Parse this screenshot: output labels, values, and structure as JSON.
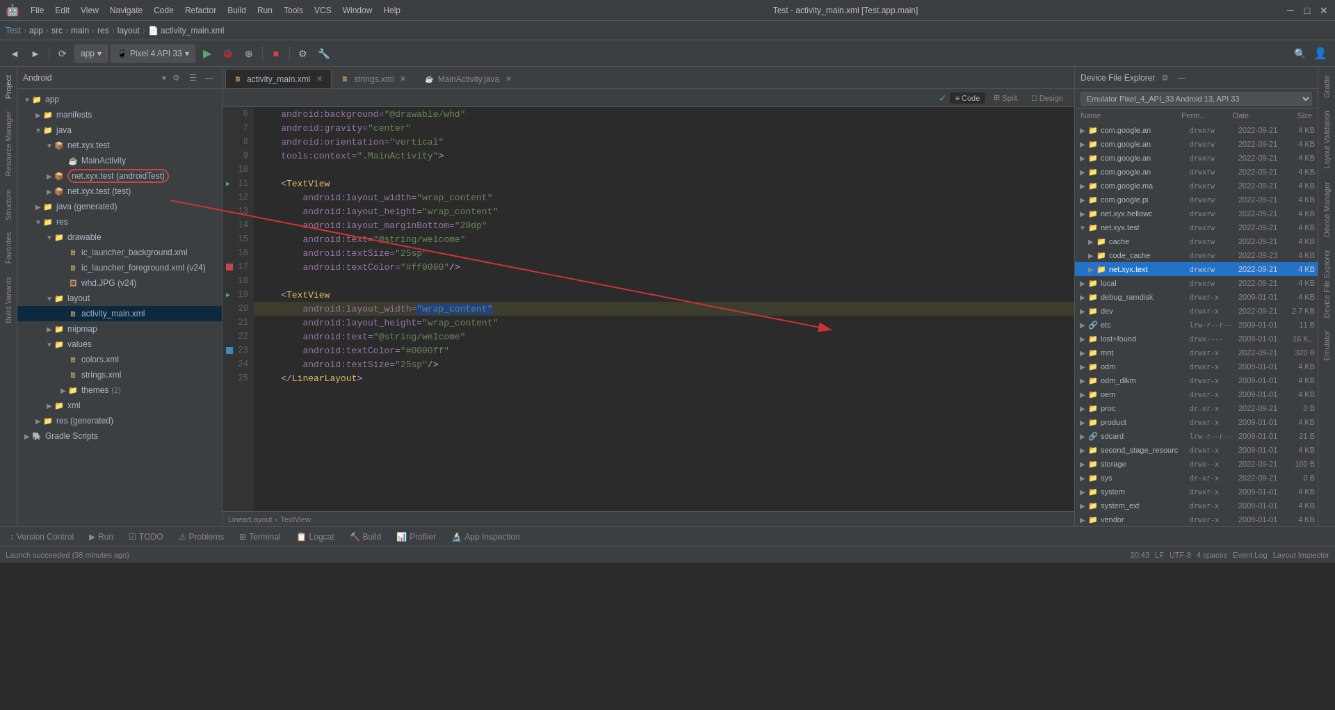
{
  "titlebar": {
    "menus": [
      "File",
      "Edit",
      "View",
      "Navigate",
      "Code",
      "Refactor",
      "Build",
      "Run",
      "Tools",
      "VCS",
      "Window",
      "Help"
    ],
    "title": "Test - activity_main.xml [Test.app.main]",
    "win_min": "─",
    "win_max": "□",
    "win_close": "✕"
  },
  "breadcrumb": {
    "items": [
      "Test",
      "app",
      "src",
      "main",
      "res",
      "layout",
      "activity_main.xml"
    ]
  },
  "toolbar": {
    "app_label": "app",
    "device_label": "Pixel 4 API 33",
    "run_icon": "▶",
    "debug_icon": "🐞",
    "sync_icon": "↻",
    "search_icon": "🔍",
    "profile_icon": "👤"
  },
  "project_panel": {
    "title": "Android",
    "items": [
      {
        "id": "app",
        "name": "app",
        "type": "folder",
        "level": 0,
        "expanded": true,
        "icon": "folder"
      },
      {
        "id": "manifests",
        "name": "manifests",
        "type": "folder",
        "level": 1,
        "expanded": false,
        "icon": "folder"
      },
      {
        "id": "java",
        "name": "java",
        "type": "folder",
        "level": 1,
        "expanded": true,
        "icon": "folder"
      },
      {
        "id": "net.xyx.test",
        "name": "net.xyx.test",
        "type": "package",
        "level": 2,
        "expanded": true,
        "icon": "package"
      },
      {
        "id": "MainActivity",
        "name": "MainActivity",
        "type": "java",
        "level": 3,
        "icon": "java"
      },
      {
        "id": "net.xyx.test.android",
        "name": "net.xyx.test (androidTest)",
        "type": "package-highlighted",
        "level": 2,
        "expanded": false,
        "icon": "package"
      },
      {
        "id": "net.xyx.test.test",
        "name": "net.xyx.test (test)",
        "type": "package",
        "level": 2,
        "expanded": false,
        "icon": "package"
      },
      {
        "id": "java-generated",
        "name": "java (generated)",
        "type": "folder",
        "level": 1,
        "icon": "folder"
      },
      {
        "id": "res",
        "name": "res",
        "type": "folder",
        "level": 1,
        "expanded": true,
        "icon": "folder"
      },
      {
        "id": "drawable",
        "name": "drawable",
        "type": "folder",
        "level": 2,
        "expanded": true,
        "icon": "folder"
      },
      {
        "id": "ic_launcher_background",
        "name": "ic_launcher_background.xml",
        "type": "xml",
        "level": 3,
        "icon": "xml"
      },
      {
        "id": "ic_launcher_foreground",
        "name": "ic_launcher_foreground.xml (v24)",
        "type": "xml",
        "level": 3,
        "icon": "xml"
      },
      {
        "id": "whd",
        "name": "whd.JPG (v24)",
        "type": "img",
        "level": 3,
        "icon": "img"
      },
      {
        "id": "layout",
        "name": "layout",
        "type": "folder",
        "level": 2,
        "expanded": true,
        "icon": "folder"
      },
      {
        "id": "activity_main",
        "name": "activity_main.xml",
        "type": "xml",
        "level": 3,
        "icon": "xml"
      },
      {
        "id": "mipmap",
        "name": "mipmap",
        "type": "folder",
        "level": 2,
        "icon": "folder"
      },
      {
        "id": "values",
        "name": "values",
        "type": "folder",
        "level": 2,
        "expanded": true,
        "icon": "folder"
      },
      {
        "id": "colors",
        "name": "colors.xml",
        "type": "xml",
        "level": 3,
        "icon": "xml"
      },
      {
        "id": "strings",
        "name": "strings.xml",
        "type": "xml",
        "level": 3,
        "icon": "xml"
      },
      {
        "id": "themes",
        "name": "themes (2)",
        "type": "folder",
        "level": 3,
        "icon": "folder"
      },
      {
        "id": "xml",
        "name": "xml",
        "type": "folder",
        "level": 2,
        "icon": "folder"
      },
      {
        "id": "res-generated",
        "name": "res (generated)",
        "type": "folder",
        "level": 1,
        "icon": "folder"
      },
      {
        "id": "gradle",
        "name": "Gradle Scripts",
        "type": "folder",
        "level": 0,
        "icon": "gradle"
      }
    ]
  },
  "editor": {
    "tabs": [
      {
        "id": "activity_main",
        "label": "activity_main.xml",
        "active": true,
        "icon": "xml"
      },
      {
        "id": "strings",
        "label": "strings.xml",
        "active": false,
        "icon": "xml"
      },
      {
        "id": "MainActivity",
        "label": "MainActivity.java",
        "active": false,
        "icon": "java"
      }
    ],
    "view_modes": [
      "Code",
      "Split",
      "Design"
    ],
    "active_view": "Code",
    "lines": [
      {
        "num": 6,
        "content": "    android:background=\"@drawable/whd\"",
        "type": "attr"
      },
      {
        "num": 7,
        "content": "    android:gravity=\"center\"",
        "type": "attr"
      },
      {
        "num": 8,
        "content": "    android:orientation=\"vertical\"",
        "type": "attr"
      },
      {
        "num": 9,
        "content": "    tools:context=\".MainActivity\">",
        "type": "attr"
      },
      {
        "num": 10,
        "content": "",
        "type": "blank"
      },
      {
        "num": 11,
        "content": "    <TextView",
        "type": "tag"
      },
      {
        "num": 12,
        "content": "        android:layout_width=\"wrap_content\"",
        "type": "attr"
      },
      {
        "num": 13,
        "content": "        android:layout_height=\"wrap_content\"",
        "type": "attr"
      },
      {
        "num": 14,
        "content": "        android:layout_marginBottom=\"20dp\"",
        "type": "attr"
      },
      {
        "num": 15,
        "content": "        android:text=\"@string/welcome\"",
        "type": "attr"
      },
      {
        "num": 16,
        "content": "        android:textSize=\"25sp\"",
        "type": "attr"
      },
      {
        "num": 17,
        "content": "        android:textColor=\"#ff0000\" />",
        "type": "attr",
        "gutter": "red"
      },
      {
        "num": 18,
        "content": "",
        "type": "blank"
      },
      {
        "num": 19,
        "content": "    <TextView",
        "type": "tag"
      },
      {
        "num": 20,
        "content": "        android:layout_width=\"wrap_content\"",
        "type": "attr",
        "highlighted": true,
        "gutter_sel": true
      },
      {
        "num": 21,
        "content": "        android:layout_height=\"wrap_content\"",
        "type": "attr"
      },
      {
        "num": 22,
        "content": "        android:text=\"@string/welcome\"",
        "type": "attr"
      },
      {
        "num": 23,
        "content": "        android:textColor=\"#0000ff\"",
        "type": "attr",
        "gutter": "blue"
      },
      {
        "num": 24,
        "content": "        android:textSize=\"25sp\"/>",
        "type": "attr"
      },
      {
        "num": 25,
        "content": "    </LinearLayout>",
        "type": "tag"
      }
    ],
    "breadcrumb": [
      "LinearLayout",
      "TextView"
    ]
  },
  "device_explorer": {
    "title": "Device File Explorer",
    "device": "Emulator Pixel_4_API_33 Android 13, API 33",
    "columns": [
      "Name",
      "Perm...",
      "Date",
      "Size"
    ],
    "files": [
      {
        "name": "com.google.an",
        "perm": "drwxrw",
        "date": "2022-09-21",
        "size": "4 KB",
        "level": 0,
        "type": "dir"
      },
      {
        "name": "com.google.an",
        "perm": "drwxrw",
        "date": "2022-09-21",
        "size": "4 KB",
        "level": 0,
        "type": "dir"
      },
      {
        "name": "com.google.an",
        "perm": "drwxrw",
        "date": "2022-09-21",
        "size": "4 KB",
        "level": 0,
        "type": "dir"
      },
      {
        "name": "com.google.an",
        "perm": "drwxrw",
        "date": "2022-09-21",
        "size": "4 KB",
        "level": 0,
        "type": "dir"
      },
      {
        "name": "com.google.ma",
        "perm": "drwxrw",
        "date": "2022-09-21",
        "size": "4 KB",
        "level": 0,
        "type": "dir"
      },
      {
        "name": "com.google.pi",
        "perm": "drwxrw",
        "date": "2022-09-21",
        "size": "4 KB",
        "level": 0,
        "type": "dir"
      },
      {
        "name": "net.xyx.hellowc",
        "perm": "drwxrw",
        "date": "2022-09-21",
        "size": "4 KB",
        "level": 0,
        "type": "dir"
      },
      {
        "name": "net.xyx.test",
        "perm": "drwxrw",
        "date": "2022-09-21",
        "size": "4 KB",
        "level": 0,
        "type": "dir",
        "expanded": true
      },
      {
        "name": "cache",
        "perm": "drwxrw",
        "date": "2022-09-21",
        "size": "4 KB",
        "level": 1,
        "type": "dir"
      },
      {
        "name": "code_cache",
        "perm": "drwxrw",
        "date": "2022-09-23",
        "size": "4 KB",
        "level": 1,
        "type": "dir"
      },
      {
        "name": "net.xyx.text",
        "perm": "drwxrw",
        "date": "2022-09-21",
        "size": "4 KB",
        "level": 1,
        "type": "dir",
        "selected": true
      },
      {
        "name": "local",
        "perm": "drwxrw",
        "date": "2022-09-21",
        "size": "4 KB",
        "level": 0,
        "type": "dir"
      },
      {
        "name": "debug_ramdisk",
        "perm": "drwxr-x",
        "date": "2009-01-01",
        "size": "4 KB",
        "level": 0,
        "type": "dir"
      },
      {
        "name": "dev",
        "perm": "drwxr-x",
        "date": "2022-09-21",
        "size": "2.7 KB",
        "level": 0,
        "type": "dir"
      },
      {
        "name": "etc",
        "perm": "lrw-r--r--",
        "date": "2009-01-01",
        "size": "11 B",
        "level": 0,
        "type": "link"
      },
      {
        "name": "lost+found",
        "perm": "drwx----",
        "date": "2009-01-01",
        "size": "16 K...",
        "level": 0,
        "type": "dir"
      },
      {
        "name": "mnt",
        "perm": "drwxr-x",
        "date": "2022-09-21",
        "size": "320 B",
        "level": 0,
        "type": "dir"
      },
      {
        "name": "odm",
        "perm": "drwxr-x",
        "date": "2009-01-01",
        "size": "4 KB",
        "level": 0,
        "type": "dir"
      },
      {
        "name": "odm_dlkm",
        "perm": "drwxr-x",
        "date": "2009-01-01",
        "size": "4 KB",
        "level": 0,
        "type": "dir"
      },
      {
        "name": "oem",
        "perm": "drwxr-x",
        "date": "2009-01-01",
        "size": "4 KB",
        "level": 0,
        "type": "dir"
      },
      {
        "name": "proc",
        "perm": "dr-xr-x",
        "date": "2022-09-21",
        "size": "0 B",
        "level": 0,
        "type": "dir"
      },
      {
        "name": "product",
        "perm": "drwxr-x",
        "date": "2009-01-01",
        "size": "4 KB",
        "level": 0,
        "type": "dir"
      },
      {
        "name": "sdcard",
        "perm": "lrw-r--r--",
        "date": "2009-01-01",
        "size": "21 B",
        "level": 0,
        "type": "link"
      },
      {
        "name": "second_stage_resourc",
        "perm": "drwxr-x",
        "date": "2009-01-01",
        "size": "4 KB",
        "level": 0,
        "type": "dir"
      },
      {
        "name": "storage",
        "perm": "drwx--x",
        "date": "2022-09-21",
        "size": "100 B",
        "level": 0,
        "type": "dir"
      },
      {
        "name": "sys",
        "perm": "dr-xr-x",
        "date": "2022-09-21",
        "size": "0 B",
        "level": 0,
        "type": "dir"
      },
      {
        "name": "system",
        "perm": "drwxr-x",
        "date": "2009-01-01",
        "size": "4 KB",
        "level": 0,
        "type": "dir"
      },
      {
        "name": "system_ext",
        "perm": "drwxr-x",
        "date": "2009-01-01",
        "size": "4 KB",
        "level": 0,
        "type": "dir"
      },
      {
        "name": "vendor",
        "perm": "drwxr-x",
        "date": "2009-01-01",
        "size": "4 KB",
        "level": 0,
        "type": "dir"
      }
    ]
  },
  "bottom_toolbar": {
    "tabs": [
      "Version Control",
      "Run",
      "TODO",
      "Problems",
      "Terminal",
      "Logcat",
      "Build",
      "Profiler",
      "App Inspection"
    ]
  },
  "statusbar": {
    "message": "Launch succeeded (38 minutes ago)",
    "position": "20:43",
    "encoding": "LF  UTF-8",
    "indent": "4 spaces",
    "event_log": "Event Log",
    "layout_inspector": "Layout Inspector"
  },
  "left_sidebar": {
    "tabs": [
      "Project",
      "Resource Manager",
      "Structure",
      "Favorites",
      "Build Variants"
    ]
  },
  "right_sidebar": {
    "tabs": [
      "Gradle",
      "Layout Validation",
      "Device Manager",
      "Device File Explorer",
      "Emulator"
    ]
  },
  "colors": {
    "accent_blue": "#2472c8",
    "selected_highlight": "#0d293e",
    "red": "#cc4444",
    "blue": "#4488bb",
    "green": "#59a869"
  }
}
